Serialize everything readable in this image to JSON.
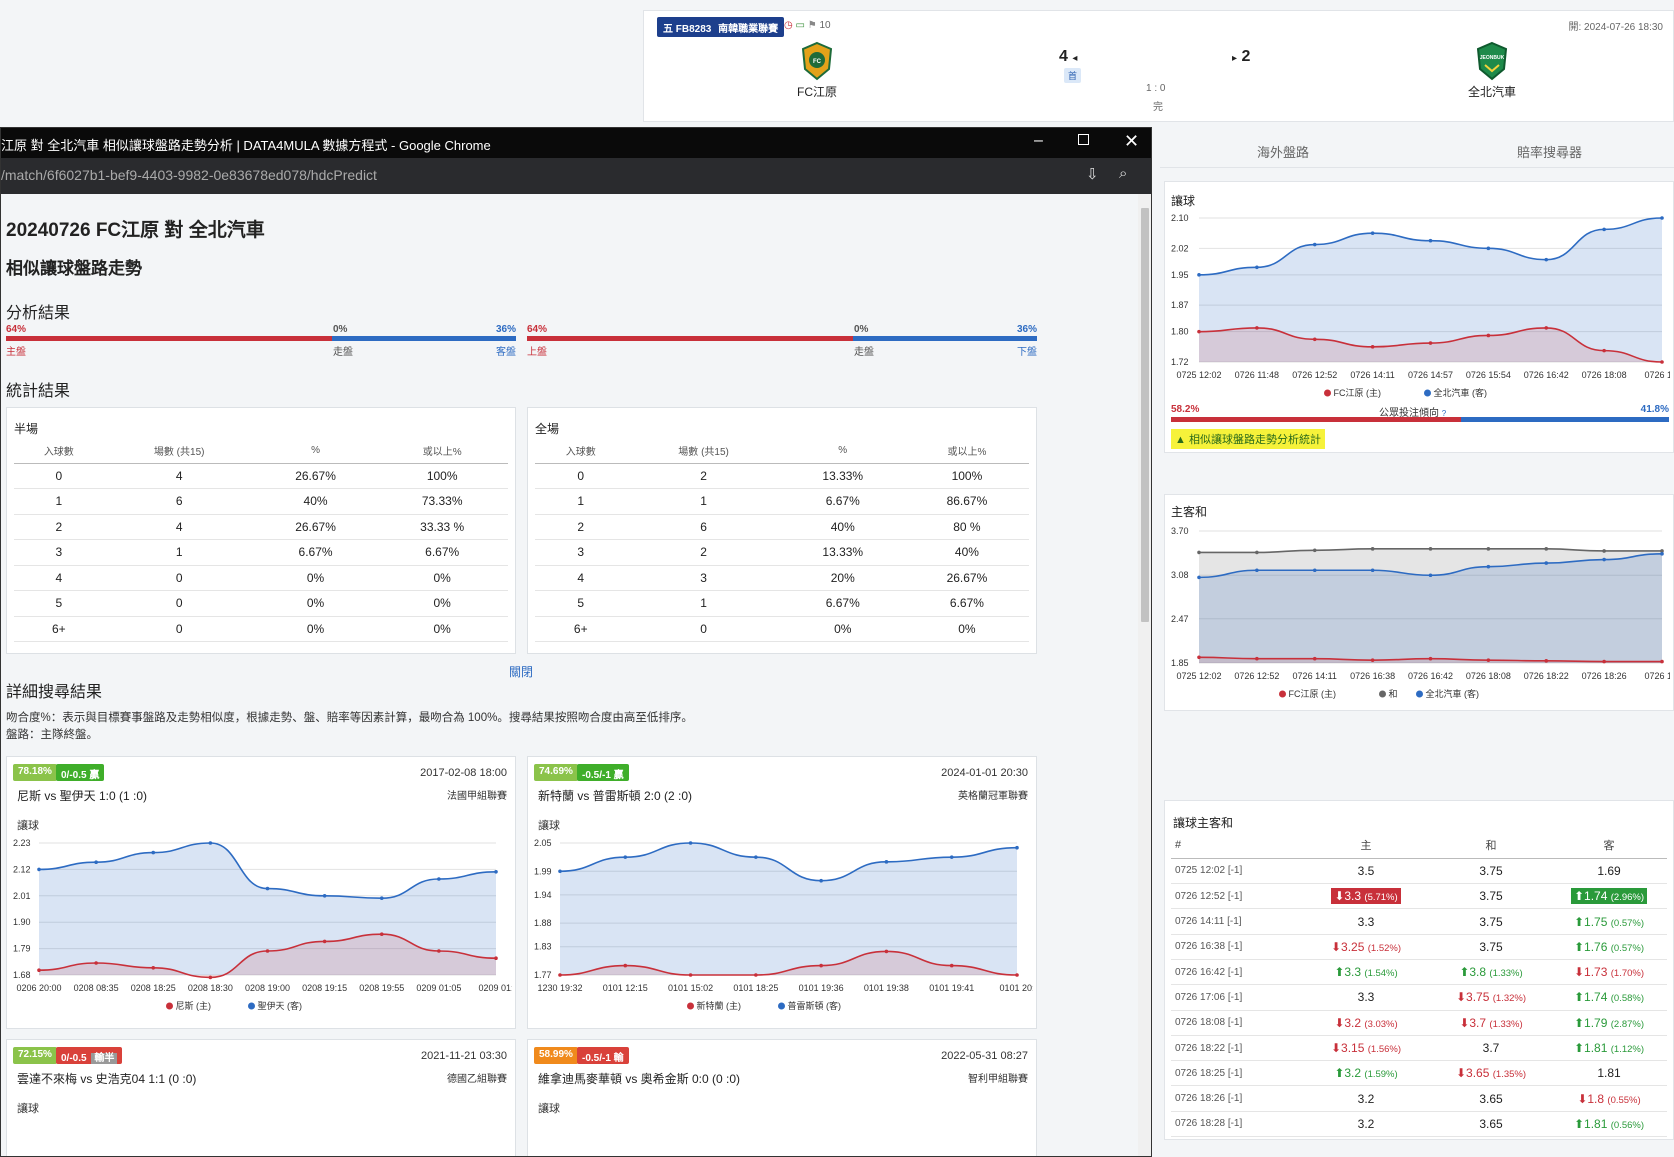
{
  "match_header": {
    "league_code": "五 FB8283",
    "league_name": "南韓職業聯賽",
    "corner_count": "10",
    "kickoff": "開: 2024-07-26 18:30",
    "home_team": "FC江原",
    "away_team": "全北汽車",
    "home_score": "4",
    "away_score": "2",
    "half_tag": "首",
    "ht_score": "1 : 0",
    "status": "完"
  },
  "right_tabs": [
    "海外盤路",
    "賠率搜尋器"
  ],
  "right_handicap_chart": {
    "title": "讓球",
    "public_left": "58.2%",
    "public_label": "公眾投注傾向",
    "public_right": "41.8%",
    "public_left_value": 58.2,
    "link_label": "相似讓球盤路走勢分析統計"
  },
  "right_1x2_chart": {
    "title": "主客和"
  },
  "odds_table": {
    "title": "讓球主客和",
    "headers": [
      "#",
      "主",
      "和",
      "客"
    ],
    "rows": [
      {
        "time": "0725 12:02 [-1]",
        "home": {
          "v": "3.5",
          "dir": "",
          "chg": "",
          "box": false
        },
        "draw": {
          "v": "3.75",
          "dir": "",
          "chg": ""
        },
        "away": {
          "v": "1.69",
          "dir": "",
          "chg": "",
          "box": false
        }
      },
      {
        "time": "0726 12:52 [-1]",
        "home": {
          "v": "3.3",
          "dir": "down",
          "chg": "(5.71%)",
          "box": true
        },
        "draw": {
          "v": "3.75",
          "dir": "",
          "chg": ""
        },
        "away": {
          "v": "1.74",
          "dir": "up",
          "chg": "(2.96%)",
          "box": true
        }
      },
      {
        "time": "0726 14:11 [-1]",
        "home": {
          "v": "3.3",
          "dir": "",
          "chg": "",
          "box": false
        },
        "draw": {
          "v": "3.75",
          "dir": "",
          "chg": ""
        },
        "away": {
          "v": "1.75",
          "dir": "up",
          "chg": "(0.57%)",
          "box": false
        }
      },
      {
        "time": "0726 16:38 [-1]",
        "home": {
          "v": "3.25",
          "dir": "down",
          "chg": "(1.52%)",
          "box": false
        },
        "draw": {
          "v": "3.75",
          "dir": "",
          "chg": ""
        },
        "away": {
          "v": "1.76",
          "dir": "up",
          "chg": "(0.57%)",
          "box": false
        }
      },
      {
        "time": "0726 16:42 [-1]",
        "home": {
          "v": "3.3",
          "dir": "up",
          "chg": "(1.54%)",
          "box": false
        },
        "draw": {
          "v": "3.8",
          "dir": "up",
          "chg": "(1.33%)"
        },
        "away": {
          "v": "1.73",
          "dir": "down",
          "chg": "(1.70%)",
          "box": false
        }
      },
      {
        "time": "0726 17:06 [-1]",
        "home": {
          "v": "3.3",
          "dir": "",
          "chg": "",
          "box": false
        },
        "draw": {
          "v": "3.75",
          "dir": "down",
          "chg": "(1.32%)"
        },
        "away": {
          "v": "1.74",
          "dir": "up",
          "chg": "(0.58%)",
          "box": false
        }
      },
      {
        "time": "0726 18:08 [-1]",
        "home": {
          "v": "3.2",
          "dir": "down",
          "chg": "(3.03%)",
          "box": false
        },
        "draw": {
          "v": "3.7",
          "dir": "down",
          "chg": "(1.33%)"
        },
        "away": {
          "v": "1.79",
          "dir": "up",
          "chg": "(2.87%)",
          "box": false
        }
      },
      {
        "time": "0726 18:22 [-1]",
        "home": {
          "v": "3.15",
          "dir": "down",
          "chg": "(1.56%)",
          "box": false
        },
        "draw": {
          "v": "3.7",
          "dir": "",
          "chg": ""
        },
        "away": {
          "v": "1.81",
          "dir": "up",
          "chg": "(1.12%)",
          "box": false
        }
      },
      {
        "time": "0726 18:25 [-1]",
        "home": {
          "v": "3.2",
          "dir": "up",
          "chg": "(1.59%)",
          "box": false
        },
        "draw": {
          "v": "3.65",
          "dir": "down",
          "chg": "(1.35%)"
        },
        "away": {
          "v": "1.81",
          "dir": "",
          "chg": "",
          "box": false
        }
      },
      {
        "time": "0726 18:26 [-1]",
        "home": {
          "v": "3.2",
          "dir": "",
          "chg": "",
          "box": false
        },
        "draw": {
          "v": "3.65",
          "dir": "",
          "chg": ""
        },
        "away": {
          "v": "1.8",
          "dir": "down",
          "chg": "(0.55%)",
          "box": false
        }
      },
      {
        "time": "0726 18:28 [-1]",
        "home": {
          "v": "3.2",
          "dir": "",
          "chg": "",
          "box": false
        },
        "draw": {
          "v": "3.65",
          "dir": "",
          "chg": ""
        },
        "away": {
          "v": "1.81",
          "dir": "up",
          "chg": "(0.56%)",
          "box": false
        }
      }
    ]
  },
  "chrome": {
    "window_title": "江原 對 全北汽車 相似讓球盤路走勢分析 | DATA4MULA 數據方程式 - Google Chrome",
    "url": "/match/6f6027b1-bef9-4403-9982-0e83678ed078/hdcPredict"
  },
  "page": {
    "title": "20240726 FC江原 對 全北汽車",
    "subtitle": "相似讓球盤路走勢",
    "analysis_heading": "分析結果",
    "stats_heading": "統計結果",
    "detail_heading": "詳細搜尋結果",
    "close_link": "關閉",
    "desc_line1": "吻合度%：表示與目標賽事盤路及走勢相似度，根據走勢、盤、賠率等因素計算，最吻合為 100%。搜尋結果按照吻合度由高至低排序。",
    "desc_line2": "盤路：主隊終盤。"
  },
  "analysis_bars": [
    {
      "left_pct": "64%",
      "mid_pct": "0%",
      "right_pct": "36%",
      "left_label": "主盤",
      "mid_label": "走盤",
      "right_label": "客盤",
      "left_value": 64
    },
    {
      "left_pct": "64%",
      "mid_pct": "0%",
      "right_pct": "36%",
      "left_label": "上盤",
      "mid_label": "走盤",
      "right_label": "下盤",
      "left_value": 64
    }
  ],
  "stat_tables": [
    {
      "title": "半場",
      "headers": [
        "入球數",
        "場數 (共15)",
        "%",
        "或以上%"
      ],
      "rows": [
        [
          "0",
          "4",
          "26.67%",
          "100%"
        ],
        [
          "1",
          "6",
          "40%",
          "73.33%"
        ],
        [
          "2",
          "4",
          "26.67%",
          "33.33 %"
        ],
        [
          "3",
          "1",
          "6.67%",
          "6.67%"
        ],
        [
          "4",
          "0",
          "0%",
          "0%"
        ],
        [
          "5",
          "0",
          "0%",
          "0%"
        ],
        [
          "6+",
          "0",
          "0%",
          "0%"
        ]
      ]
    },
    {
      "title": "全場",
      "headers": [
        "入球數",
        "場數 (共15)",
        "%",
        "或以上%"
      ],
      "rows": [
        [
          "0",
          "2",
          "13.33%",
          "100%"
        ],
        [
          "1",
          "1",
          "6.67%",
          "86.67%"
        ],
        [
          "2",
          "6",
          "40%",
          "80 %"
        ],
        [
          "3",
          "2",
          "13.33%",
          "40%"
        ],
        [
          "4",
          "3",
          "20%",
          "26.67%"
        ],
        [
          "5",
          "1",
          "6.67%",
          "6.67%"
        ],
        [
          "6+",
          "0",
          "0%",
          "0%"
        ]
      ]
    }
  ],
  "result_cards": [
    {
      "match_pct": "78.18%",
      "hdc": "0/-0.5 贏",
      "hdc_color": "#3fae2a",
      "extra": "",
      "date": "2017-02-08 18:00",
      "match": "尼斯 vs 聖伊天 1:0 (1 :0)",
      "league": "法國甲組聯賽",
      "chart_title": "讓球"
    },
    {
      "match_pct": "74.69%",
      "hdc": "-0.5/-1 贏",
      "hdc_color": "#3fae2a",
      "extra": "",
      "date": "2024-01-01 20:30",
      "match": "新特蘭 vs 普雷斯頓 2:0 (2 :0)",
      "league": "英格蘭冠軍聯賽",
      "chart_title": "讓球"
    },
    {
      "match_pct": "72.15%",
      "hdc": "0/-0.5",
      "hdc_color": "#d9413a",
      "extra": "輸半",
      "date": "2021-11-21 03:30",
      "match": "雲達不來梅 vs 史浩克04 1:1 (0 :0)",
      "league": "德國乙組聯賽",
      "chart_title": "讓球"
    },
    {
      "match_pct": "58.99%",
      "hdc": "-0.5/-1 輸",
      "hdc_color": "#d9413a",
      "extra": "",
      "date": "2022-05-31 08:27",
      "match": "維拿迪馬麥華頓 vs 奧希金斯 0:0 (0 :0)",
      "league": "智利甲組聯賽",
      "chart_title": "讓球"
    }
  ],
  "colors": {
    "home": "#c8303a",
    "away": "#2d6bc2",
    "draw": "#666666",
    "league_badge": "#1d3f8c",
    "win_green": "#3fae2a",
    "pct_green": "#8bc34a",
    "pct_orange": "#f08a1c"
  },
  "chart_data": [
    {
      "type": "area",
      "title": "讓球",
      "x": [
        "0725 12:02",
        "0726 11:48",
        "0726 12:52",
        "0726 14:11",
        "0726 14:57",
        "0726 15:54",
        "0726 16:42",
        "0726 18:08",
        "0726 18:"
      ],
      "ylim": [
        1.72,
        2.1
      ],
      "yticks": [
        "1.72",
        "1.80",
        "1.87",
        "1.95",
        "2.02",
        "2.10"
      ],
      "series": [
        {
          "name": "FC江原 (主)",
          "values": [
            1.8,
            1.81,
            1.78,
            1.76,
            1.77,
            1.79,
            1.81,
            1.75,
            1.72
          ]
        },
        {
          "name": "全北汽車 (客)",
          "values": [
            1.95,
            1.97,
            2.03,
            2.06,
            2.04,
            2.02,
            1.99,
            2.07,
            2.1
          ]
        }
      ],
      "legend": "bottom"
    },
    {
      "type": "area",
      "title": "主客和",
      "x": [
        "0725 12:02",
        "0726 12:52",
        "0726 14:11",
        "0726 16:38",
        "0726 16:42",
        "0726 18:08",
        "0726 18:22",
        "0726 18:26",
        "0726 18:"
      ],
      "ylim": [
        1.85,
        3.7
      ],
      "yticks": [
        "1.85",
        "2.47",
        "3.08",
        "3.70"
      ],
      "series": [
        {
          "name": "FC江原 (主)",
          "values": [
            1.93,
            1.91,
            1.91,
            1.89,
            1.91,
            1.89,
            1.88,
            1.87,
            1.87
          ]
        },
        {
          "name": "和",
          "values": [
            3.4,
            3.4,
            3.43,
            3.45,
            3.45,
            3.45,
            3.45,
            3.42,
            3.42
          ]
        },
        {
          "name": "全北汽車 (客)",
          "values": [
            3.05,
            3.15,
            3.15,
            3.15,
            3.08,
            3.2,
            3.25,
            3.3,
            3.38
          ]
        }
      ],
      "legend": "bottom"
    },
    {
      "type": "area",
      "title": "讓球",
      "x": [
        "0206 20:00",
        "0208 08:35",
        "0208 18:25",
        "0208 18:30",
        "0208 19:00",
        "0208 19:15",
        "0208 19:55",
        "0209 01:05",
        "0209 01:"
      ],
      "ylim": [
        1.68,
        2.23
      ],
      "yticks": [
        "1.68",
        "1.79",
        "1.90",
        "2.01",
        "2.12",
        "2.23"
      ],
      "series": [
        {
          "name": "尼斯 (主)",
          "values": [
            1.7,
            1.73,
            1.71,
            1.67,
            1.78,
            1.82,
            1.85,
            1.78,
            1.75
          ]
        },
        {
          "name": "聖伊天 (客)",
          "values": [
            2.12,
            2.15,
            2.19,
            2.23,
            2.04,
            2.01,
            2.0,
            2.08,
            2.11
          ]
        }
      ],
      "legend": "bottom"
    },
    {
      "type": "area",
      "title": "讓球",
      "x": [
        "1230 19:32",
        "0101 12:15",
        "0101 15:02",
        "0101 18:25",
        "0101 19:36",
        "0101 19:38",
        "0101 19:41",
        "0101 20:"
      ],
      "ylim": [
        1.77,
        2.05
      ],
      "yticks": [
        "1.77",
        "1.83",
        "1.88",
        "1.94",
        "1.99",
        "2.05"
      ],
      "series": [
        {
          "name": "新特蘭 (主)",
          "values": [
            1.77,
            1.79,
            1.77,
            1.77,
            1.79,
            1.82,
            1.79,
            1.77
          ]
        },
        {
          "name": "普雷斯頓 (客)",
          "values": [
            1.99,
            2.02,
            2.05,
            2.02,
            1.97,
            2.01,
            2.02,
            2.04
          ]
        }
      ],
      "legend": "bottom"
    }
  ]
}
